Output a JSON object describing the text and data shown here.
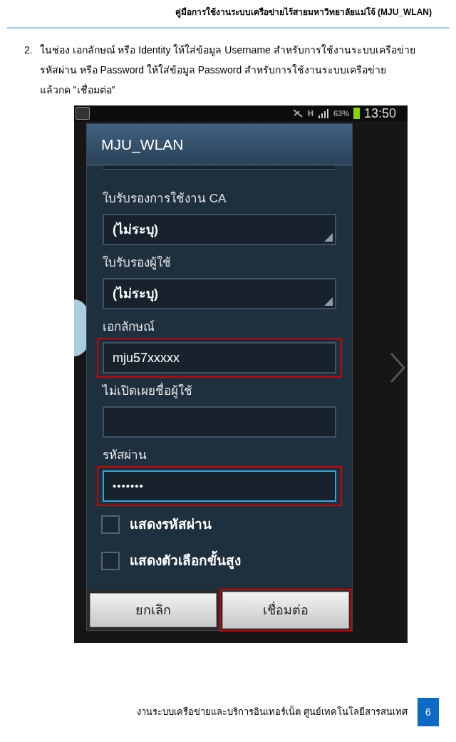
{
  "header": {
    "title": "คู่มือการใช้งานระบบเครือข่ายไร้สายมหาวิทยาลัยแม่โจ้ (MJU_WLAN)"
  },
  "instruction": {
    "number": "2.",
    "lines": [
      "ในช่อง เอกลักษณ์ หรือ Identity ให้ใส่ข้อมูล Username  สำหรับการใช้งานระบบเครือข่าย",
      "รหัสผ่าน หรือ Password  ให้ใส่ข้อมูล Password สำหรับการใช้งานระบบเครือข่าย",
      "แล้วกด \"เชื่อมต่อ\""
    ]
  },
  "phone": {
    "status_bar": {
      "network": "H",
      "battery": "63%",
      "time": "13:50"
    },
    "dialog": {
      "title": "MJU_WLAN",
      "fields": [
        {
          "kind": "dropdown",
          "label": "ใบรับรองการใช้งาน CA",
          "value": "(ไม่ระบุ)",
          "highlighted": false,
          "focused": false
        },
        {
          "kind": "dropdown",
          "label": "ใบรับรองผู้ใช้",
          "value": "(ไม่ระบุ)",
          "highlighted": false,
          "focused": false
        },
        {
          "kind": "text",
          "label": "เอกลักษณ์",
          "value": "mju57xxxxx",
          "highlighted": true,
          "focused": false
        },
        {
          "kind": "text",
          "label": "ไม่เปิดเผยชื่อผู้ใช้",
          "highlighted": false,
          "focused": false
        },
        {
          "kind": "password",
          "label": "รหัสผ่าน",
          "value": "•••••••",
          "highlighted": true,
          "focused": true
        }
      ],
      "checkboxes": [
        {
          "label": "แสดงรหัสผ่าน",
          "checked": false
        },
        {
          "label": "แสดงตัวเลือกขั้นสูง",
          "checked": false
        }
      ],
      "buttons": [
        {
          "label": "ยกเลิก",
          "highlighted": false
        },
        {
          "label": "เชื่อมต่อ",
          "highlighted": true
        }
      ]
    }
  },
  "footer": {
    "text": "งานระบบเครือข่ายและบริการอินเทอร์เน็ต ศูนย์เทคโนโลยีสารสนเทศ",
    "page_number": "6"
  }
}
